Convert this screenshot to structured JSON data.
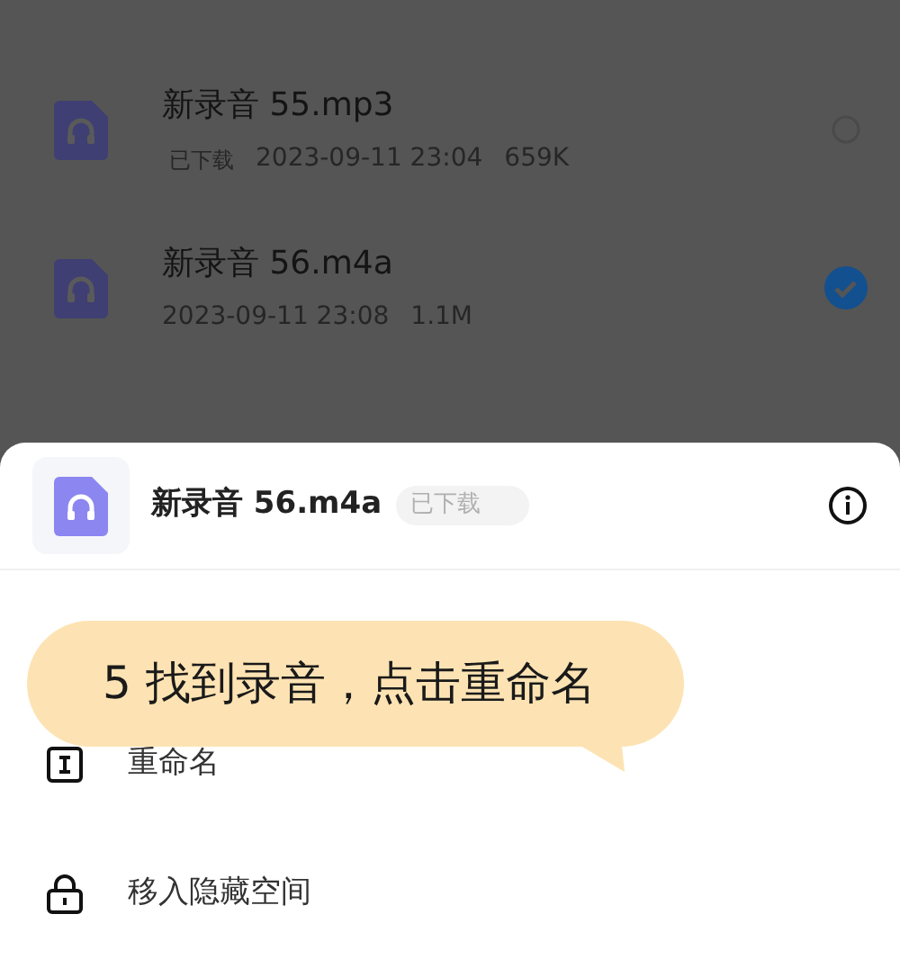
{
  "files": [
    {
      "name": "新录音 55.mp3",
      "badge": "已下载",
      "date": "2023-09-11 23:04",
      "size": "659K",
      "selected": false
    },
    {
      "name": "新录音 56.m4a",
      "date": "2023-09-11 23:08",
      "size": "1.1M",
      "selected": true
    }
  ],
  "sheet": {
    "name": "新录音 56.m4a",
    "badge": "已下载",
    "actions": [
      {
        "kind": "rename",
        "label": "重命名"
      },
      {
        "kind": "lock",
        "label": "移入隐藏空间"
      }
    ]
  },
  "callout": {
    "text": "5 找到录音，点击重命名"
  }
}
